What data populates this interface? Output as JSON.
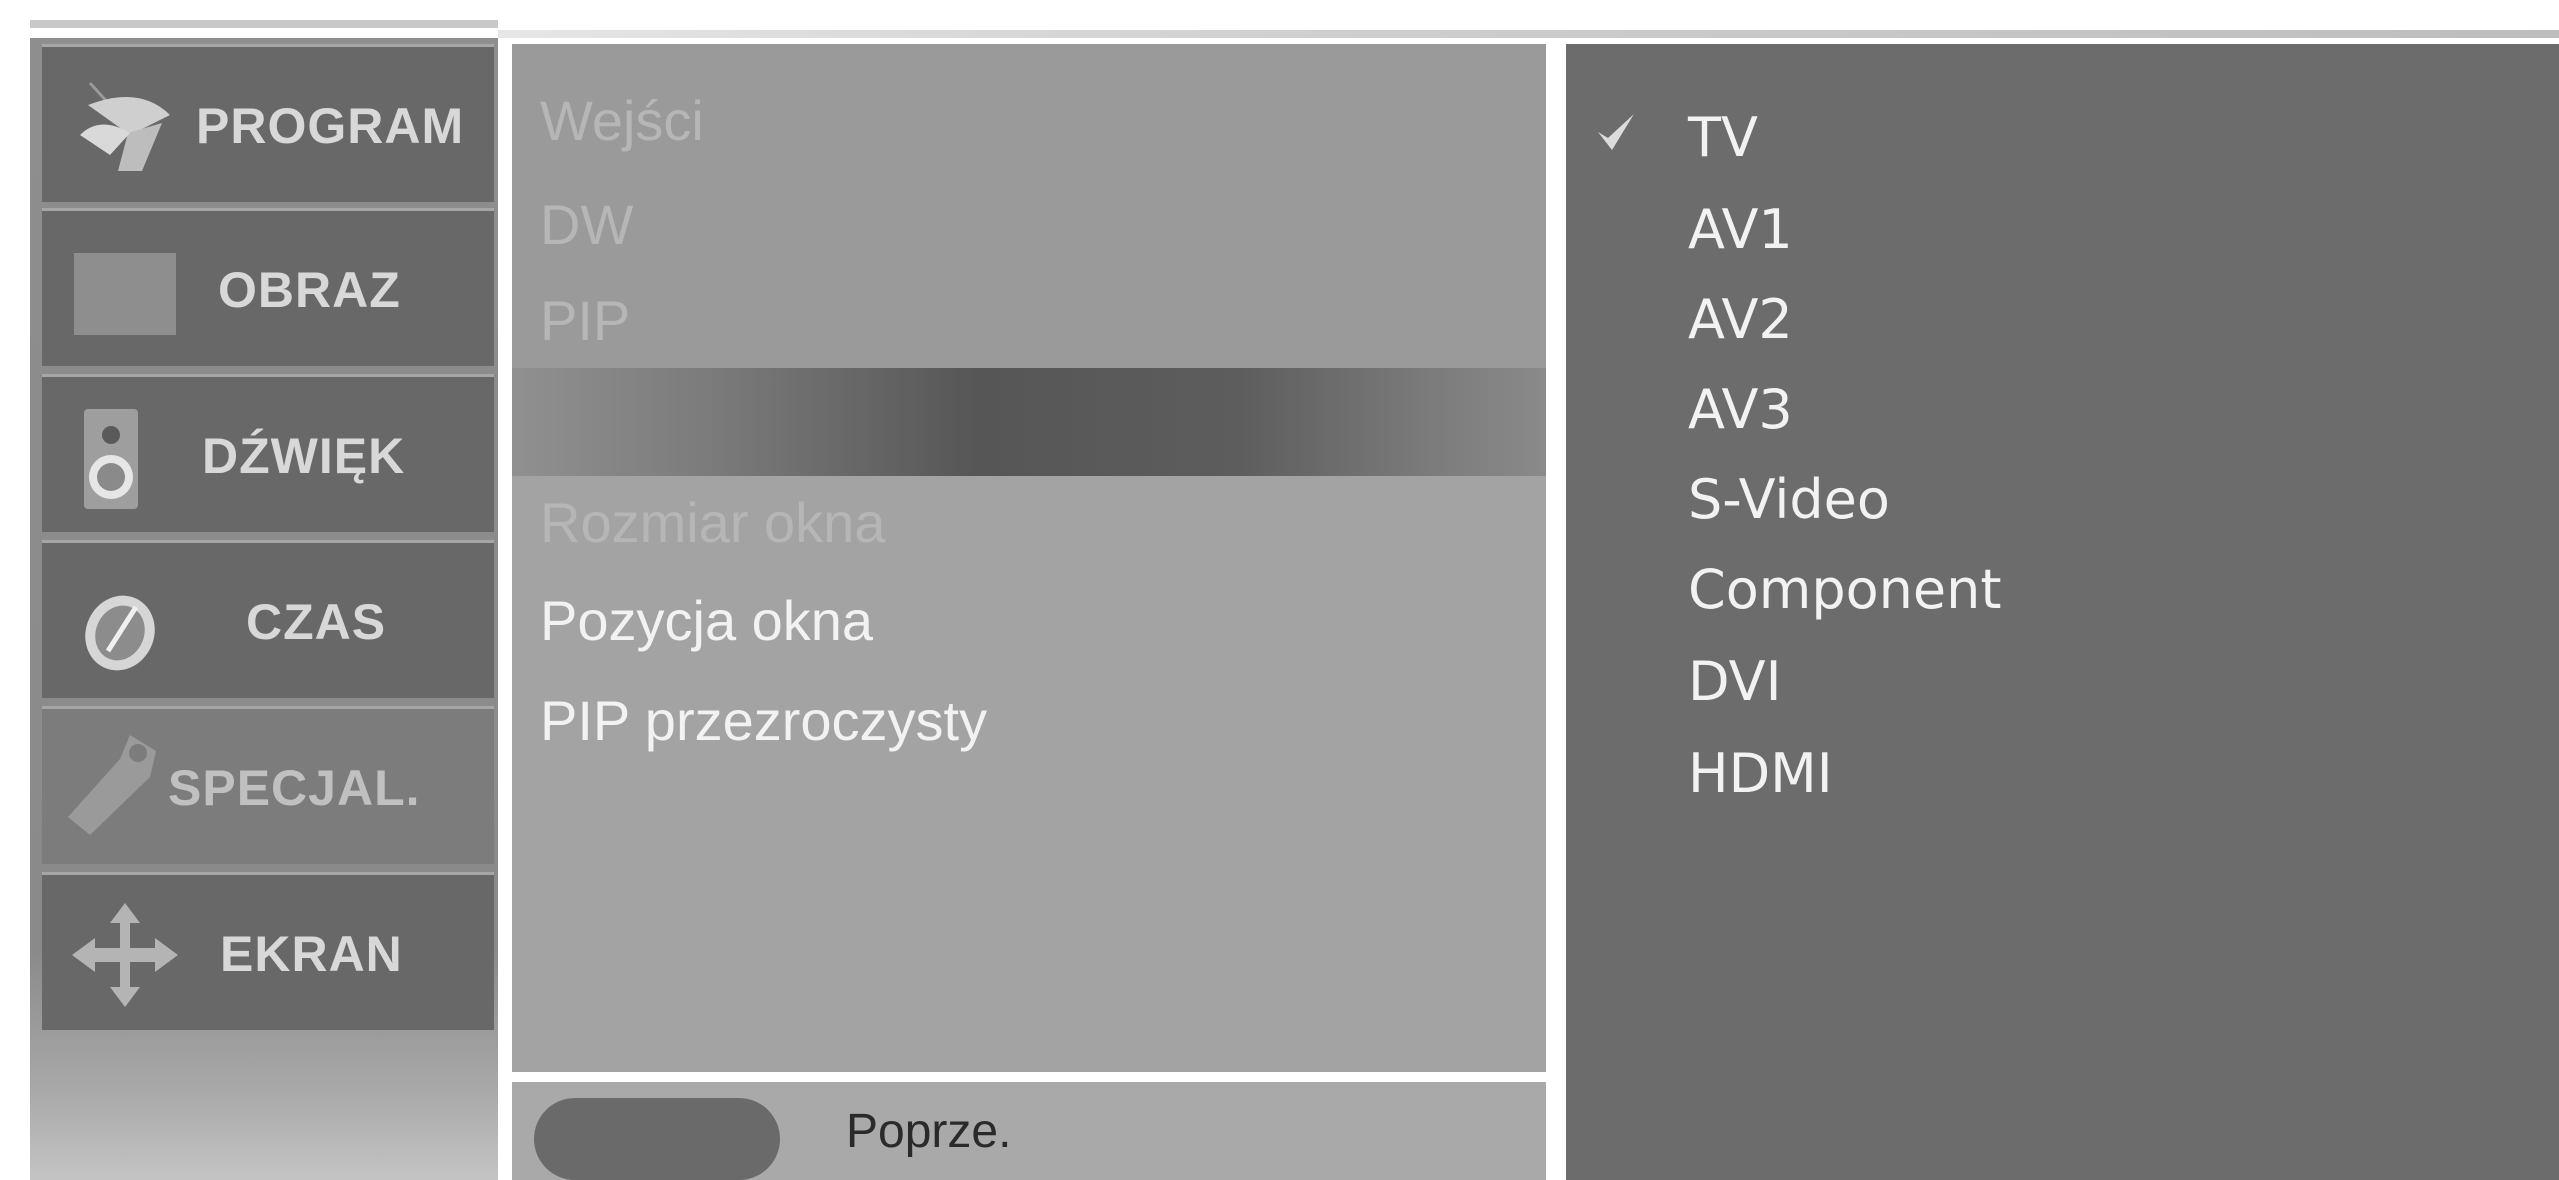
{
  "categories": [
    {
      "label": "PROGRAM",
      "icon": "satellite-dish-icon"
    },
    {
      "label": "OBRAZ",
      "icon": "picture-square-icon"
    },
    {
      "label": "DŹWIĘK",
      "icon": "speaker-icon"
    },
    {
      "label": "CZAS",
      "icon": "clock-icon"
    },
    {
      "label": "SPECJAL.",
      "icon": "tag-icon"
    },
    {
      "label": "EKRAN",
      "icon": "move-arrows-icon"
    }
  ],
  "menu": {
    "items": [
      {
        "label": "Wejści"
      },
      {
        "label": "DW"
      },
      {
        "label": "PIP"
      },
      {
        "label": "Rozmiar okna"
      },
      {
        "label": "Pozycja okna"
      },
      {
        "label": "PIP przezroczysty"
      }
    ]
  },
  "submenu": {
    "items": [
      "TV",
      "AV1",
      "AV2",
      "AV3",
      "S-Video",
      "Component",
      "DVI",
      "HDMI"
    ],
    "checked_icon": "checkmark-icon"
  },
  "footer": {
    "prev_label": "Poprze."
  },
  "colors": {
    "panel_dark": "#6c6c6c",
    "panel_mid": "#a3a3a3",
    "text_light": "#f2f2f2"
  }
}
